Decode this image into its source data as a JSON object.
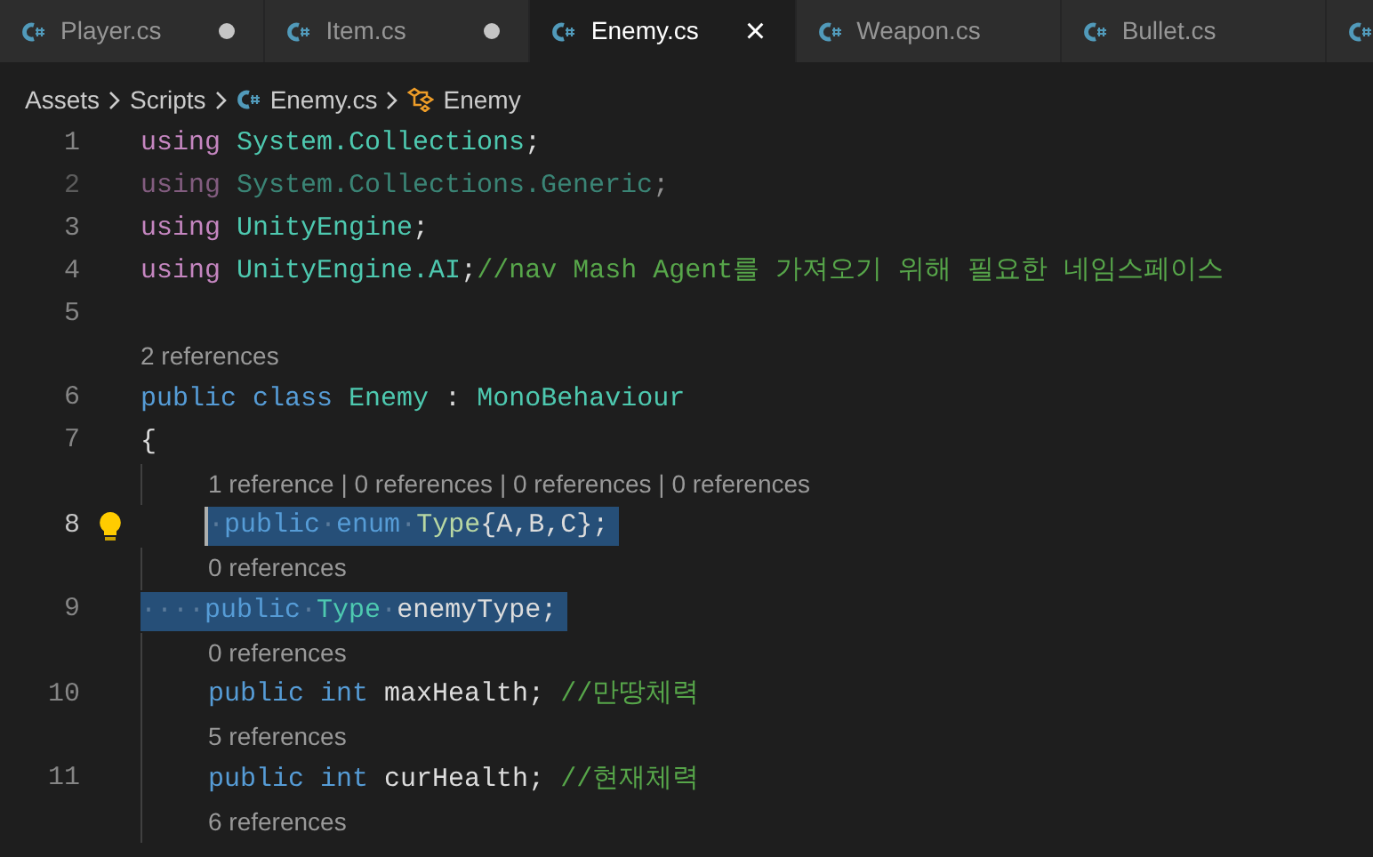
{
  "tabs": [
    {
      "label": "Player.cs",
      "selected": false,
      "dirty": true
    },
    {
      "label": "Item.cs",
      "selected": false,
      "dirty": true
    },
    {
      "label": "Enemy.cs",
      "selected": true,
      "dirty": false,
      "close": "×"
    },
    {
      "label": "Weapon.cs",
      "selected": false,
      "dirty": false
    },
    {
      "label": "Bullet.cs",
      "selected": false,
      "dirty": false
    }
  ],
  "breadcrumb": [
    "Assets",
    "Scripts",
    "Enemy.cs",
    "Enemy"
  ],
  "lines": [
    {
      "kind": "code",
      "number": "1",
      "selected": false,
      "tokens": [
        {
          "text": "using",
          "kind": "directive"
        },
        {
          "text": " System.Collections",
          "kind": "type"
        },
        {
          "text": ";",
          "kind": "plain"
        }
      ]
    },
    {
      "kind": "code",
      "number": "2",
      "selected": false,
      "faded": true,
      "tokens": [
        {
          "text": "using",
          "kind": "directive"
        },
        {
          "text": " System.Collections.Generic",
          "kind": "type"
        },
        {
          "text": ";",
          "kind": "plain"
        }
      ]
    },
    {
      "kind": "code",
      "number": "3",
      "selected": false,
      "tokens": [
        {
          "text": "using",
          "kind": "directive"
        },
        {
          "text": " UnityEngine",
          "kind": "type"
        },
        {
          "text": ";",
          "kind": "plain"
        }
      ]
    },
    {
      "kind": "code",
      "number": "4",
      "selected": false,
      "tokens": [
        {
          "text": "using",
          "kind": "directive"
        },
        {
          "text": " UnityEngine.AI",
          "kind": "type"
        },
        {
          "text": ";",
          "kind": "plain"
        },
        {
          "text": "//nav Mash Agent를 가져오기 위해 필요한 네임스페이스",
          "kind": "comment"
        }
      ]
    },
    {
      "kind": "code",
      "number": "5"
    },
    {
      "kind": "lens",
      "text": "2 references"
    },
    {
      "kind": "code",
      "number": "6",
      "selected": false,
      "tokens": [
        {
          "text": "public",
          "kind": "keyword"
        },
        {
          "text": " class",
          "kind": "keyword"
        },
        {
          "text": " Enemy",
          "kind": "type"
        },
        {
          "text": " :",
          "kind": "plain"
        },
        {
          "text": " MonoBehaviour",
          "kind": "type"
        }
      ]
    },
    {
      "kind": "code",
      "number": "7",
      "selected": false,
      "tokens": [
        {
          "text": "{",
          "kind": "plain"
        }
      ]
    },
    {
      "kind": "lens",
      "indented": true,
      "text": "1 reference | 0 references | 0 references | 0 references"
    },
    {
      "kind": "code",
      "number": "8",
      "indented": true,
      "selected": true,
      "current": true,
      "lightbulb": true,
      "tokens": [
        {
          "text": "·",
          "kind": "ws"
        },
        {
          "text": "public",
          "kind": "keyword"
        },
        {
          "text": "·",
          "kind": "ws"
        },
        {
          "text": "enum",
          "kind": "keyword"
        },
        {
          "text": "·",
          "kind": "ws"
        },
        {
          "text": "Type",
          "kind": "enum"
        },
        {
          "text": "{A,B,C};",
          "kind": "plain"
        }
      ]
    },
    {
      "kind": "lens",
      "indented": true,
      "text": "0 references"
    },
    {
      "kind": "code",
      "number": "9",
      "selected": true,
      "tokens": [
        {
          "text": "····",
          "kind": "ws"
        },
        {
          "text": "public",
          "kind": "keyword"
        },
        {
          "text": "·",
          "kind": "ws"
        },
        {
          "text": "Type",
          "kind": "type"
        },
        {
          "text": "·",
          "kind": "ws"
        },
        {
          "text": "enemyType;",
          "kind": "plain"
        }
      ]
    },
    {
      "kind": "lens",
      "indented": true,
      "text": "0 references"
    },
    {
      "kind": "code",
      "number": "10",
      "indented": true,
      "selected": false,
      "tokens": [
        {
          "text": "public",
          "kind": "keyword"
        },
        {
          "text": " int",
          "kind": "keyword"
        },
        {
          "text": " maxHealth;",
          "kind": "plain"
        },
        {
          "text": " //만땅체력",
          "kind": "comment"
        }
      ]
    },
    {
      "kind": "lens",
      "indented": true,
      "text": "5 references"
    },
    {
      "kind": "code",
      "number": "11",
      "indented": true,
      "selected": false,
      "tokens": [
        {
          "text": "public",
          "kind": "keyword"
        },
        {
          "text": " int",
          "kind": "keyword"
        },
        {
          "text": " curHealth;",
          "kind": "plain"
        },
        {
          "text": " //현재체력",
          "kind": "comment"
        }
      ]
    },
    {
      "kind": "lens",
      "indented": true,
      "text": "6 references"
    }
  ]
}
